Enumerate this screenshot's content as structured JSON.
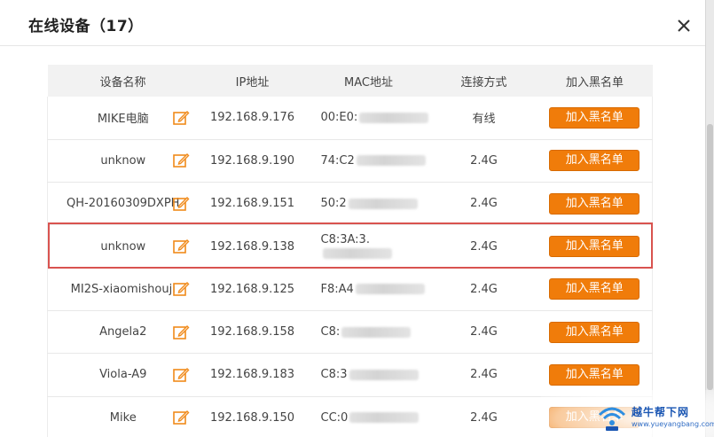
{
  "dialog": {
    "title": "在线设备（17）"
  },
  "table": {
    "headers": [
      "设备名称",
      "IP地址",
      "MAC地址",
      "连接方式",
      "加入黑名单"
    ],
    "rows": [
      {
        "name": "MIKE电脑",
        "ip": "192.168.9.176",
        "mac": "00:E0:",
        "conn": "有线",
        "action": "加入黑名单"
      },
      {
        "name": "unknow",
        "ip": "192.168.9.190",
        "mac": "74:C2",
        "conn": "2.4G",
        "action": "加入黑名单"
      },
      {
        "name": "QH-20160309DXPH",
        "ip": "192.168.9.151",
        "mac": "50:2",
        "conn": "2.4G",
        "action": "加入黑名单"
      },
      {
        "name": "unknow",
        "ip": "192.168.9.138",
        "mac": "C8:3A:3.",
        "conn": "2.4G",
        "action": "加入黑名单"
      },
      {
        "name": "MI2S-xiaomishouji",
        "ip": "192.168.9.125",
        "mac": "F8:A4",
        "conn": "2.4G",
        "action": "加入黑名单"
      },
      {
        "name": "Angela2",
        "ip": "192.168.9.158",
        "mac": "C8:",
        "conn": "2.4G",
        "action": "加入黑名单"
      },
      {
        "name": "Viola-A9",
        "ip": "192.168.9.183",
        "mac": "C8:3",
        "conn": "2.4G",
        "action": "加入黑名单"
      },
      {
        "name": "Mike",
        "ip": "192.168.9.150",
        "mac": "CC:0",
        "conn": "2.4G",
        "action": "加入黑名单"
      }
    ]
  },
  "highlighted_row_index": 3,
  "watermark": {
    "brand": "越牛帮下网",
    "url": "www.yueyangbang.com"
  },
  "colors": {
    "accent": "#f07c0a",
    "highlight": "#d9534f",
    "header_bg": "#f2f2f2"
  },
  "icons": {
    "edit": "edit-icon",
    "close": "close-icon"
  }
}
